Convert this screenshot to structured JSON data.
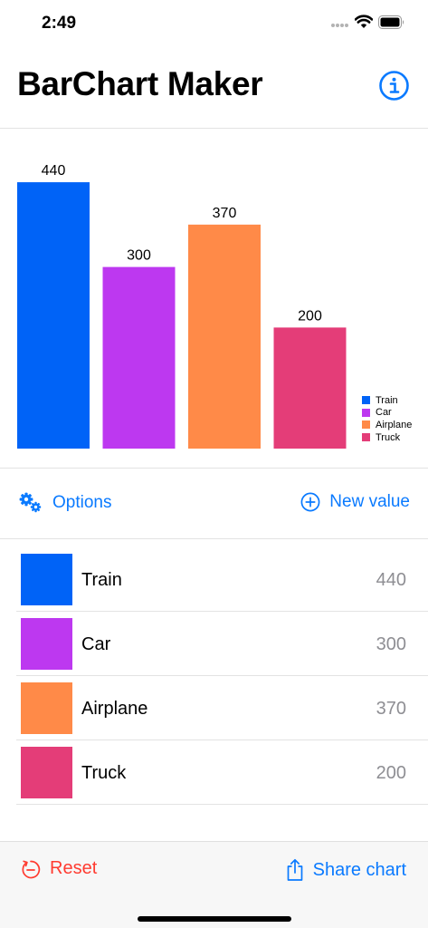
{
  "status_bar": {
    "time": "2:49"
  },
  "header": {
    "title": "BarChart Maker",
    "info_icon": "info-circle-icon"
  },
  "chart_data": {
    "type": "bar",
    "categories": [
      "Train",
      "Car",
      "Airplane",
      "Truck"
    ],
    "values": [
      440,
      300,
      370,
      200
    ],
    "colors": [
      "#0063f7",
      "#bd38f0",
      "#ff8a48",
      "#e43d78"
    ],
    "ylim": [
      0,
      500
    ],
    "legend_position": "bottom-right",
    "title": "",
    "xlabel": "",
    "ylabel": ""
  },
  "actions": {
    "options_label": "Options",
    "new_value_label": "New value"
  },
  "items": [
    {
      "label": "Train",
      "value": "440",
      "color": "#0063f7"
    },
    {
      "label": "Car",
      "value": "300",
      "color": "#bd38f0"
    },
    {
      "label": "Airplane",
      "value": "370",
      "color": "#ff8a48"
    },
    {
      "label": "Truck",
      "value": "200",
      "color": "#e43d78"
    }
  ],
  "toolbar": {
    "reset_label": "Reset",
    "share_label": "Share chart"
  },
  "colors": {
    "accent": "#0a7aff",
    "destructive": "#ff3b30",
    "secondary_text": "#8e8e93"
  }
}
